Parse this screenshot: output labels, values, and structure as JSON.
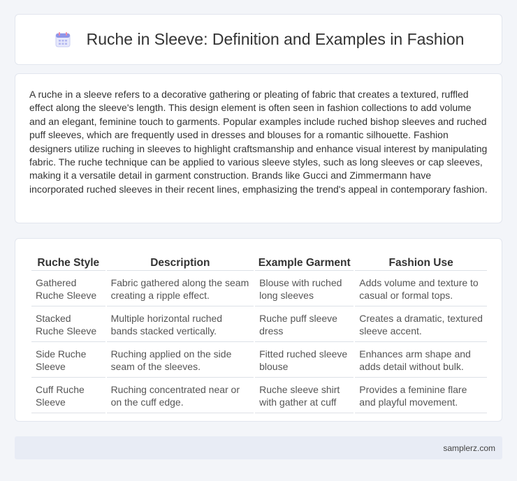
{
  "header": {
    "title": "Ruche in Sleeve: Definition and Examples in Fashion",
    "icon": "calendar-icon"
  },
  "intro": {
    "text": "A ruche in a sleeve refers to a decorative gathering or pleating of fabric that creates a textured, ruffled effect along the sleeve's length. This design element is often seen in fashion collections to add volume and an elegant, feminine touch to garments. Popular examples include ruched bishop sleeves and ruched puff sleeves, which are frequently used in dresses and blouses for a romantic silhouette. Fashion designers utilize ruching in sleeves to highlight craftsmanship and enhance visual interest by manipulating fabric. The ruche technique can be applied to various sleeve styles, such as long sleeves or cap sleeves, making it a versatile detail in garment construction. Brands like Gucci and Zimmermann have incorporated ruched sleeves in their recent lines, emphasizing the trend's appeal in contemporary fashion."
  },
  "table": {
    "headers": [
      "Ruche Style",
      "Description",
      "Example Garment",
      "Fashion Use"
    ],
    "rows": [
      [
        "Gathered Ruche Sleeve",
        "Fabric gathered along the seam creating a ripple effect.",
        "Blouse with ruched long sleeves",
        "Adds volume and texture to casual or formal tops."
      ],
      [
        "Stacked Ruche Sleeve",
        "Multiple horizontal ruched bands stacked vertically.",
        "Ruche puff sleeve dress",
        "Creates a dramatic, textured sleeve accent."
      ],
      [
        "Side Ruche Sleeve",
        "Ruching applied on the side seam of the sleeves.",
        "Fitted ruched sleeve blouse",
        "Enhances arm shape and adds detail without bulk."
      ],
      [
        "Cuff Ruche Sleeve",
        "Ruching concentrated near or on the cuff edge.",
        "Ruche sleeve shirt with gather at cuff",
        "Provides a feminine flare and playful movement."
      ]
    ]
  },
  "footer": {
    "text": "samplerz.com"
  }
}
